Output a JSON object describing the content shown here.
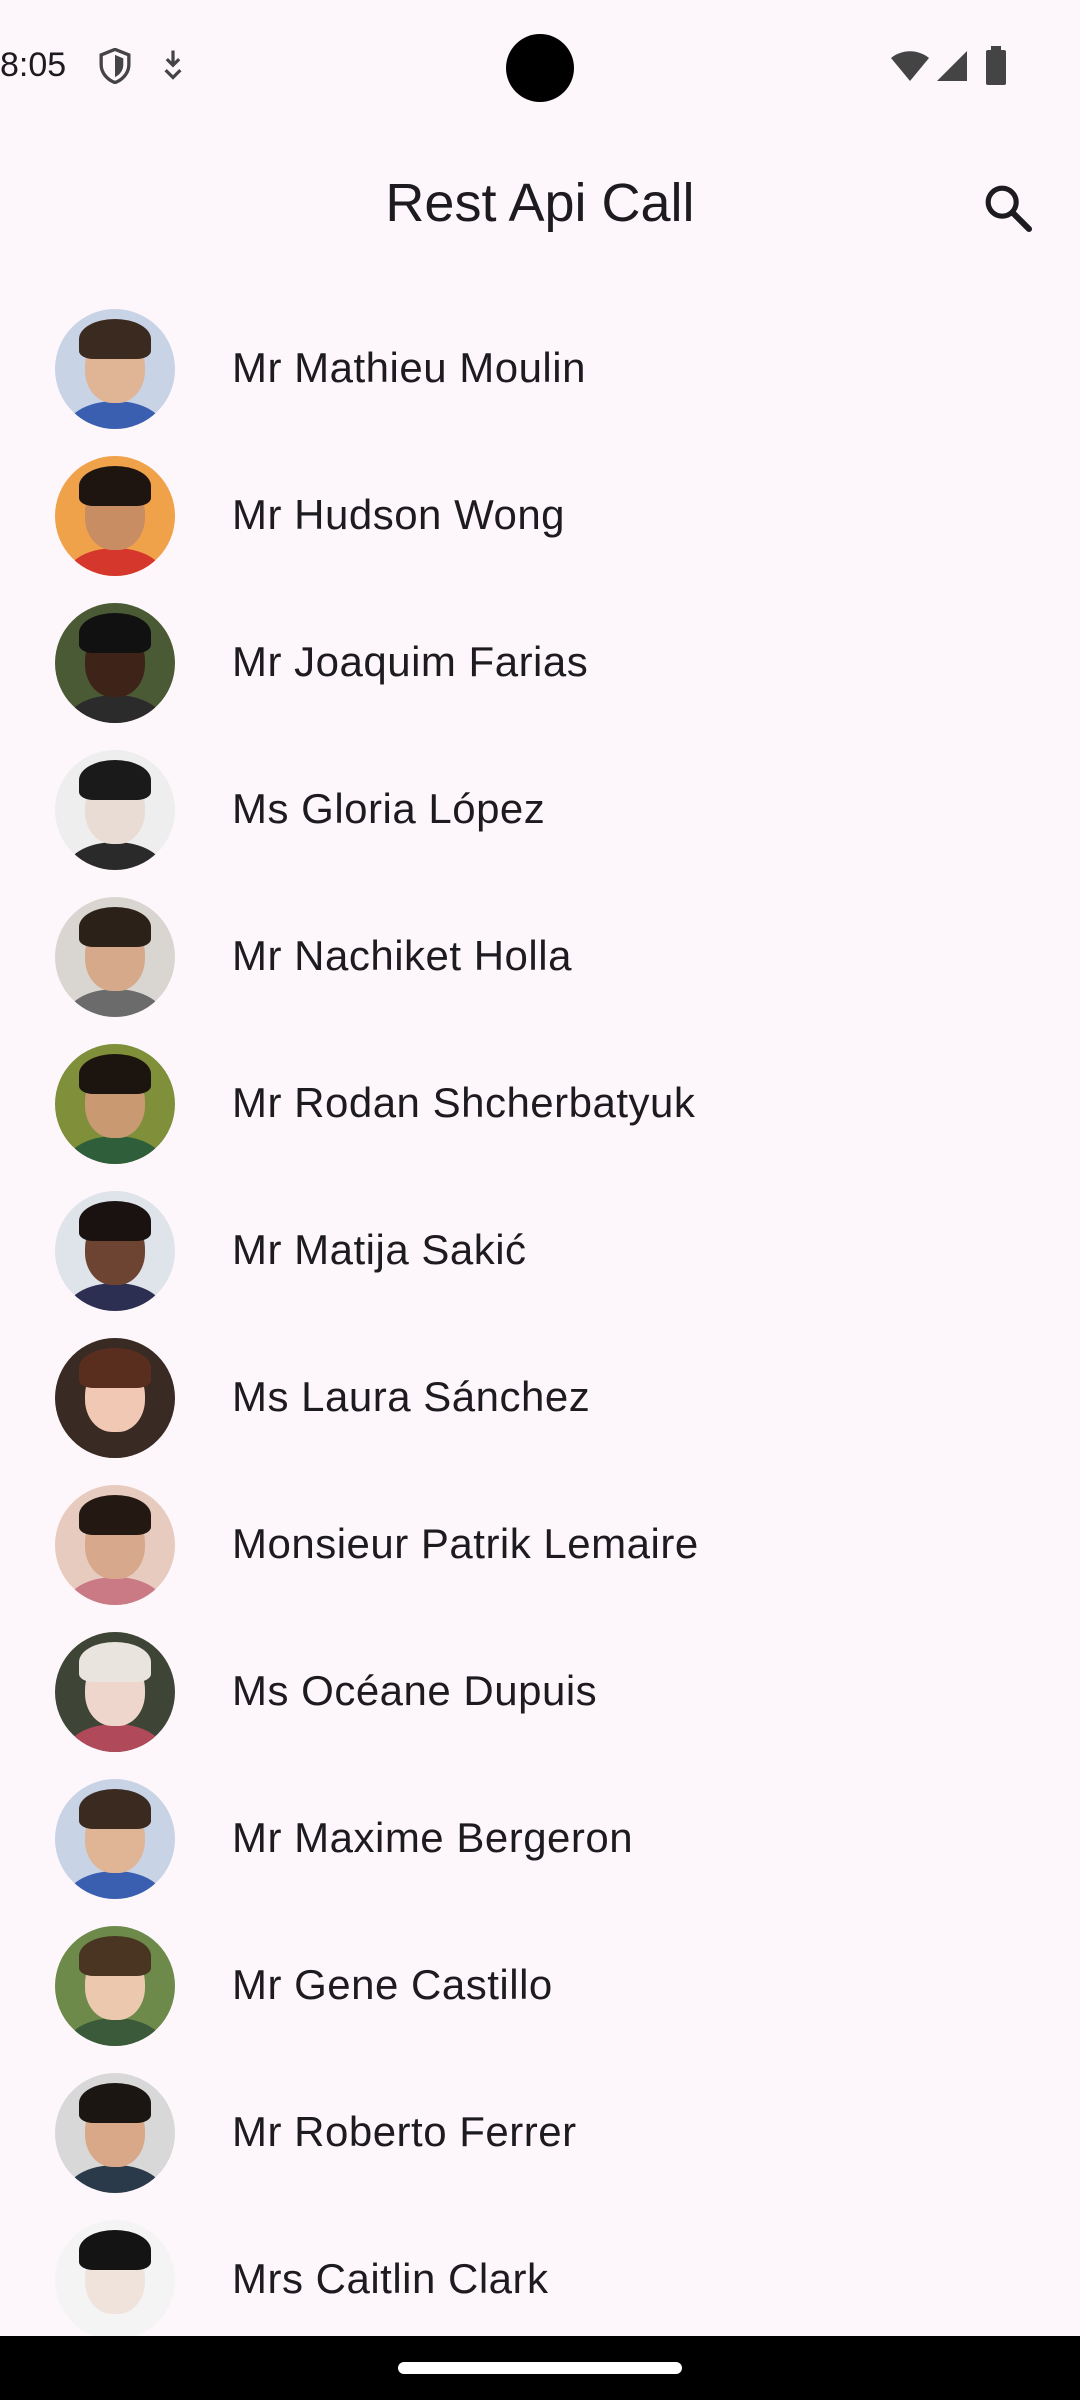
{
  "status_bar": {
    "time": "8:05",
    "left_icons": [
      "shield-icon",
      "download-icon"
    ],
    "right_icons": [
      "wifi-icon",
      "signal-icon",
      "battery-icon"
    ]
  },
  "app_bar": {
    "title": "Rest Api Call",
    "search_icon": "search-icon"
  },
  "users": [
    {
      "name": "Mr Mathieu Moulin",
      "bg": "#c9d3e6",
      "skin": "#e0b596",
      "hair": "#3a2a20",
      "shirt": "#3b5fb0"
    },
    {
      "name": "Mr Hudson Wong",
      "bg": "#f0a24a",
      "skin": "#c98d64",
      "hair": "#1e1510",
      "shirt": "#d6372c"
    },
    {
      "name": "Mr Joaquim Farias",
      "bg": "#4a5a34",
      "skin": "#3e2418",
      "hair": "#111111",
      "shirt": "#2b2b2b"
    },
    {
      "name": "Ms Gloria López",
      "bg": "#eeeeee",
      "skin": "#e9dcd4",
      "hair": "#1a1a1a",
      "shirt": "#2a2a2a"
    },
    {
      "name": "Mr Nachiket Holla",
      "bg": "#d9d6d2",
      "skin": "#d6a98a",
      "hair": "#2c2119",
      "shirt": "#6b6b6b"
    },
    {
      "name": "Mr Rodan Shcherbatyuk",
      "bg": "#7f8f3a",
      "skin": "#c99a72",
      "hair": "#1c140f",
      "shirt": "#2f5e3a"
    },
    {
      "name": "Mr Matija Sakić",
      "bg": "#dfe3ea",
      "skin": "#6d4331",
      "hair": "#1a1210",
      "shirt": "#2d2f52"
    },
    {
      "name": "Ms Laura Sánchez",
      "bg": "#3a2a24",
      "skin": "#f0c8b4",
      "hair": "#5a2e1e",
      "shirt": "#3a2a24"
    },
    {
      "name": "Monsieur Patrik Lemaire",
      "bg": "#e8cbbf",
      "skin": "#d8a88c",
      "hair": "#241812",
      "shirt": "#c97a84"
    },
    {
      "name": "Ms Océane Dupuis",
      "bg": "#3e4436",
      "skin": "#efd6cc",
      "hair": "#e9e4de",
      "shirt": "#b04a5a"
    },
    {
      "name": "Mr Maxime Bergeron",
      "bg": "#c9d3e6",
      "skin": "#e0b596",
      "hair": "#3a2a20",
      "shirt": "#3b5fb0"
    },
    {
      "name": "Mr Gene Castillo",
      "bg": "#6d8a4a",
      "skin": "#ecc8ae",
      "hair": "#4a3422",
      "shirt": "#3a5a3a"
    },
    {
      "name": "Mr Roberto Ferrer",
      "bg": "#d8d8d8",
      "skin": "#d9a888",
      "hair": "#1c1612",
      "shirt": "#2a3a4a"
    },
    {
      "name": "Mrs Caitlin Clark",
      "bg": "#f4f4f4",
      "skin": "#efe3dc",
      "hair": "#141414",
      "shirt": "#f4f4f4"
    }
  ],
  "colors": {
    "background": "#fdf7fb",
    "text": "#1d1b20",
    "nav_bar": "#000000"
  }
}
